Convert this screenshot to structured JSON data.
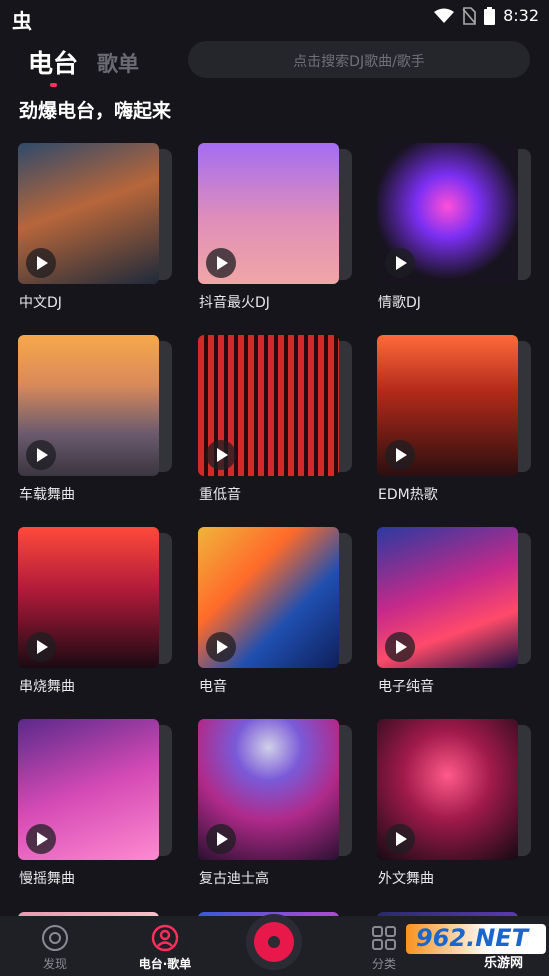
{
  "status_bar": {
    "left_glyph": "虫",
    "time": "8:32",
    "icons": [
      "wifi-icon",
      "no-sim-icon",
      "battery-icon"
    ]
  },
  "header": {
    "tab_active": "电台",
    "tab_inactive": "歌单",
    "search_placeholder": "点击搜索DJ歌曲/歌手"
  },
  "section": {
    "title": "劲爆电台，嗨起来"
  },
  "cards": [
    {
      "label": "中文DJ",
      "bg": "linear-gradient(160deg,#2f4a6b 0%,#b7663a 45%,#1e2a3a 100%)"
    },
    {
      "label": "抖音最火DJ",
      "bg": "linear-gradient(180deg,#a46df2 0%,#e08fb8 55%,#f0a6a6 100%)"
    },
    {
      "label": "情歌DJ",
      "bg": "radial-gradient(circle at 50% 45%,#ff4fd8 0%,#7b2ff2 30%,#17131f 70%)"
    },
    {
      "label": "车载舞曲",
      "bg": "linear-gradient(180deg,#f7a84a 0%,#d98a5a 35%,#6b5a6e 70%,#3a3640 100%)"
    },
    {
      "label": "重低音",
      "bg": "repeating-linear-gradient(90deg,#d12a2a 0px,#d12a2a 6px,#2a0810 6px,#2a0810 10px)"
    },
    {
      "label": "EDM热歌",
      "bg": "linear-gradient(180deg,#ff6a3a 0%,#b22a1a 40%,#2b0f0f 100%)"
    },
    {
      "label": "串烧舞曲",
      "bg": "linear-gradient(180deg,#ff4a3a 0%,#b01a3a 45%,#1a0a12 100%)"
    },
    {
      "label": "电音",
      "bg": "linear-gradient(135deg,#f0b43a 0%,#ff6a2a 35%,#1f4fb0 65%,#0f1f5a 100%)"
    },
    {
      "label": "电子纯音",
      "bg": "linear-gradient(160deg,#2a3aa0 0%,#c52a8a 45%,#ff4a6a 70%,#1a1040 100%)"
    },
    {
      "label": "慢摇舞曲",
      "bg": "linear-gradient(160deg,#5a2a8a 0%,#d44ab5 50%,#ff8ad0 100%)"
    },
    {
      "label": "复古迪士高",
      "bg": "radial-gradient(circle at 50% 20%,#d0d0e8 0%,#7a5ad8 25%,#b02a8a 55%,#2a1030 100%)"
    },
    {
      "label": "外文舞曲",
      "bg": "radial-gradient(circle at 50% 40%,#ff5a8a 0%,#a01a4a 40%,#140a12 100%)"
    }
  ],
  "bottom_nav": {
    "items": [
      {
        "label": "发现"
      },
      {
        "label": "电台·歌单"
      },
      {
        "label": "分类"
      }
    ],
    "accent": "#ff2f5c"
  },
  "watermark": {
    "text": "962.NET",
    "sub": "乐游网"
  }
}
